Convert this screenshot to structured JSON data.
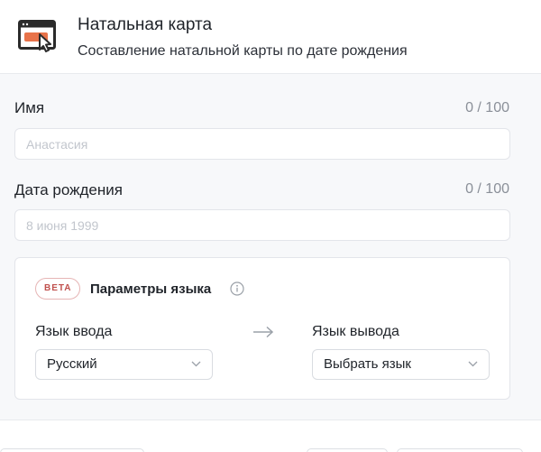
{
  "app": {
    "title": "Натальная карта",
    "subtitle": "Составление натальной карты по дате рождения",
    "icon": "browser-cursor-icon",
    "accent_color": "#e8734a"
  },
  "form": {
    "name": {
      "label": "Имя",
      "counter": "0 / 100",
      "placeholder": "Анастасия",
      "value": ""
    },
    "birth_date": {
      "label": "Дата рождения",
      "counter": "0 / 100",
      "placeholder": "8 июня 1999",
      "value": ""
    }
  },
  "language": {
    "badge": "BETA",
    "title": "Параметры языка",
    "input_label": "Язык ввода",
    "input_value": "Русский",
    "output_label": "Язык вывода",
    "output_value": "Выбрать язык"
  }
}
